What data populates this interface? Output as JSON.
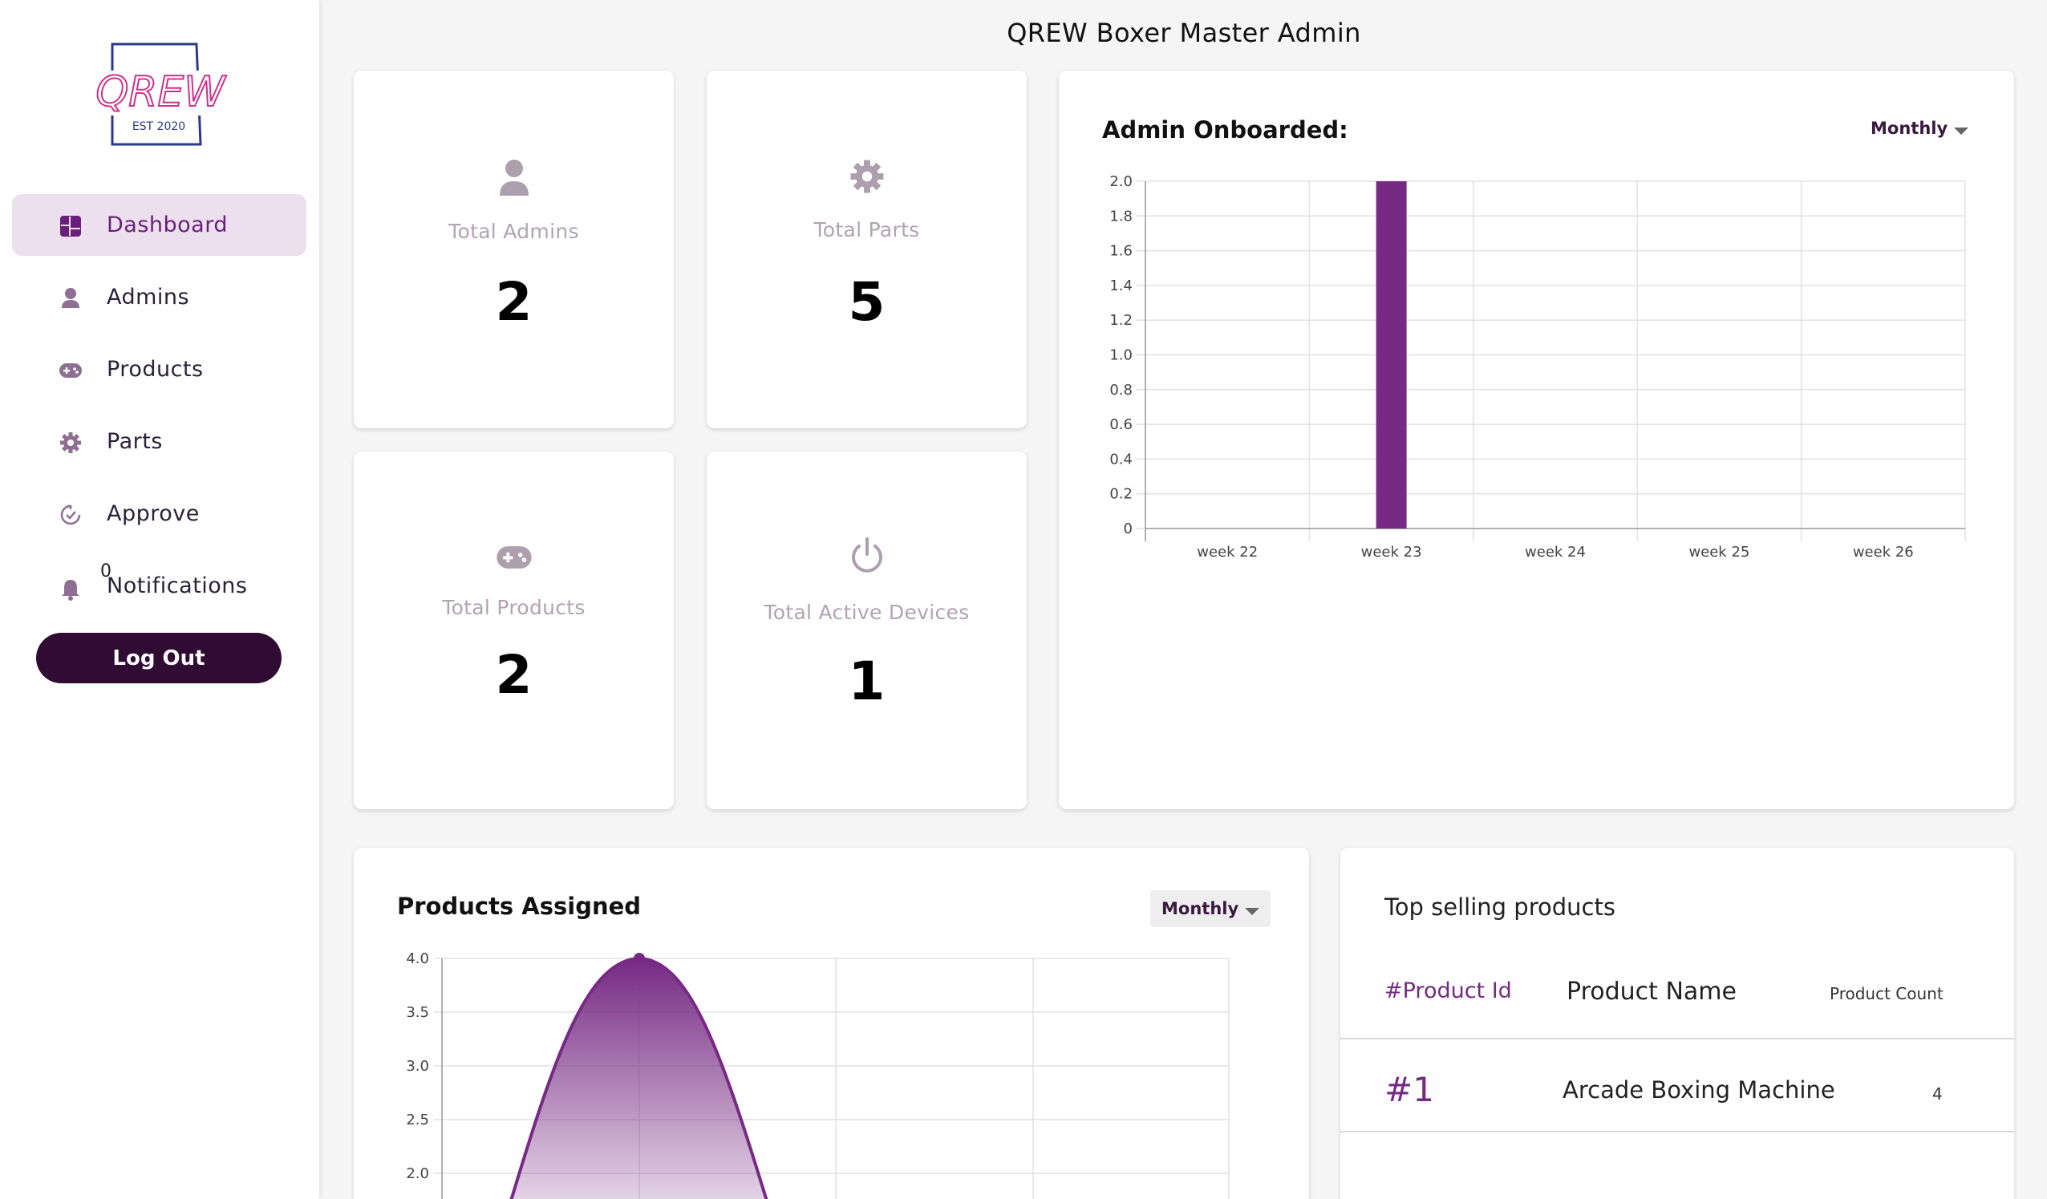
{
  "app": {
    "title": "QREW Boxer Master Admin",
    "logo_text": "QREW",
    "logo_subtext": "EST 2020"
  },
  "sidebar": {
    "items": [
      {
        "label": "Dashboard",
        "icon": "dashboard-icon",
        "active": true
      },
      {
        "label": "Admins",
        "icon": "person-icon",
        "active": false
      },
      {
        "label": "Products",
        "icon": "gamepad-icon",
        "active": false
      },
      {
        "label": "Parts",
        "icon": "gear-icon",
        "active": false
      },
      {
        "label": "Approve",
        "icon": "approve-icon",
        "active": false
      },
      {
        "label": "Notifications",
        "icon": "bell-icon",
        "active": false,
        "badge": "0"
      }
    ],
    "logout_label": "Log Out"
  },
  "stats": {
    "admins": {
      "label": "Total Admins",
      "value": "2",
      "icon": "person-icon"
    },
    "parts": {
      "label": "Total Parts",
      "value": "5",
      "icon": "gear-icon"
    },
    "products": {
      "label": "Total Products",
      "value": "2",
      "icon": "gamepad-icon"
    },
    "devices": {
      "label": "Total Active Devices",
      "value": "1",
      "icon": "power-icon"
    }
  },
  "admin_chart": {
    "title": "Admin Onboarded:",
    "period": "Monthly"
  },
  "products_chart": {
    "title": "Products Assigned",
    "period": "Monthly"
  },
  "top_selling": {
    "title": "Top selling products",
    "columns": {
      "id": "#Product Id",
      "name": "Product Name",
      "count": "Product Count"
    },
    "rows": [
      {
        "id": "#1",
        "name": "Arcade Boxing Machine",
        "count": "4"
      }
    ]
  },
  "colors": {
    "accent": "#762a83",
    "sidebar_active_bg": "#ecdfee",
    "logout_bg": "#300b33",
    "icon_grey": "#ad9fae"
  },
  "chart_data": [
    {
      "type": "bar",
      "title": "Admin Onboarded:",
      "categories": [
        "week 22",
        "week 23",
        "week 24",
        "week 25",
        "week 26"
      ],
      "values": [
        0,
        2,
        0,
        0,
        0
      ],
      "ylim": [
        0,
        2.0
      ],
      "yticks": [
        "0",
        "0.2",
        "0.4",
        "0.6",
        "0.8",
        "1.0",
        "1.2",
        "1.4",
        "1.6",
        "1.8",
        "2.0"
      ],
      "grid": true,
      "color": "#762a83"
    },
    {
      "type": "area",
      "title": "Products Assigned",
      "visible_yticks": [
        "2.0",
        "2.5",
        "3.0",
        "3.5",
        "4.0"
      ],
      "ylim_top": 4.0,
      "peak_value": 4,
      "grid": true,
      "color": "#762a83"
    }
  ]
}
